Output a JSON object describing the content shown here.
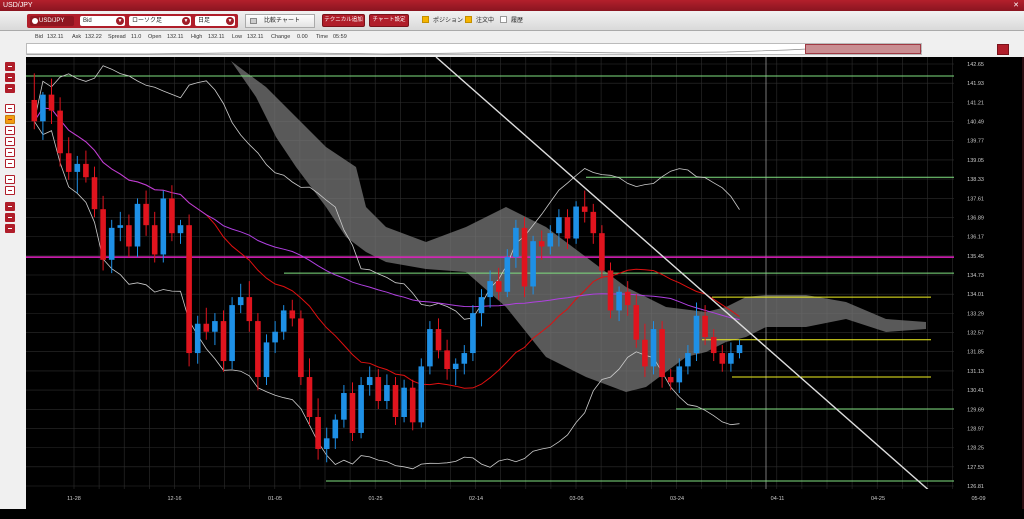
{
  "window": {
    "title": "USD/JPY",
    "close_glyph": "✕"
  },
  "toolbar": {
    "symbol": "USD/JPY",
    "price_type": "Bid",
    "chart_type": "ローソク足",
    "period": "日足",
    "compare_label": "比較チャート",
    "add_technical_label": "テクニカル追加",
    "chart_settings_label": "チャート設定",
    "checks": [
      {
        "label": "ポジション",
        "checked": true
      },
      {
        "label": "注文中",
        "checked": true
      },
      {
        "label": "履歴",
        "checked": false
      }
    ]
  },
  "quote": {
    "bid_label": "Bid",
    "bid": "132.11",
    "ask_label": "Ask",
    "ask": "132.22",
    "spread_label": "Spread",
    "spread": "11.0",
    "open_label": "Open",
    "open": "132.11",
    "high_label": "High",
    "high": "132.11",
    "low_label": "Low",
    "low": "132.11",
    "change_label": "Change",
    "change": "0.00",
    "time_label": "Time",
    "time": "05:59"
  },
  "left_tools": [
    "cursor-tool",
    "zoom-tool",
    "scroll-tool",
    "trendline-tool",
    "pen-tool",
    "horizontal-line-tool",
    "vertical-line-tool",
    "channel-tool",
    "fibonacci-tool",
    "text-tool",
    "delete-tool",
    "lock-tool",
    "save-tool",
    "settings-tool"
  ],
  "chart_data": {
    "type": "candlestick",
    "yaxis_ticks": [
      "142.65",
      "141.93",
      "141.21",
      "140.49",
      "139.77",
      "139.05",
      "138.33",
      "137.61",
      "136.89",
      "136.17",
      "135.45",
      "134.73",
      "134.01",
      "133.29",
      "132.57",
      "131.85",
      "131.13",
      "130.41",
      "129.69",
      "128.97",
      "128.25",
      "127.53",
      "126.81"
    ],
    "ylim": [
      126.81,
      142.65
    ],
    "xaxis_ticks": [
      "11-28",
      "12-16",
      "01-05",
      "01-25",
      "02-14",
      "03-06",
      "03-24",
      "04-11",
      "04-25",
      "05-09"
    ],
    "colors": {
      "up": "#1e90e6",
      "down": "#e0141e",
      "ma_short": "#e01010",
      "ma_long": "#b040e0",
      "bollinger": "#cccccc",
      "cloud": "#777777",
      "horizontal_magenta": "#e020c0",
      "horizontal_green": "#80e080",
      "horizontal_yellow": "#f0f020",
      "trendline": "#dddddd"
    },
    "candles": [
      [
        141.3,
        142.3,
        140.2,
        140.5
      ],
      [
        140.5,
        141.6,
        139.8,
        141.5
      ],
      [
        141.5,
        142.1,
        140.4,
        140.9
      ],
      [
        140.9,
        141.4,
        138.8,
        139.3
      ],
      [
        139.3,
        139.9,
        138.3,
        138.6
      ],
      [
        138.6,
        139.2,
        137.8,
        138.9
      ],
      [
        138.9,
        139.4,
        138.2,
        138.4
      ],
      [
        138.4,
        138.8,
        136.9,
        137.2
      ],
      [
        137.2,
        137.7,
        134.9,
        135.3
      ],
      [
        135.3,
        136.8,
        134.8,
        136.5
      ],
      [
        136.5,
        137.1,
        136.0,
        136.6
      ],
      [
        136.6,
        137.0,
        135.4,
        135.8
      ],
      [
        135.8,
        137.6,
        135.4,
        137.4
      ],
      [
        137.4,
        137.9,
        136.2,
        136.6
      ],
      [
        136.6,
        137.1,
        135.2,
        135.5
      ],
      [
        135.5,
        137.9,
        135.2,
        137.6
      ],
      [
        137.6,
        138.1,
        136.0,
        136.3
      ],
      [
        136.3,
        136.8,
        135.9,
        136.6
      ],
      [
        136.6,
        137.0,
        131.3,
        131.8
      ],
      [
        131.8,
        133.2,
        131.4,
        132.9
      ],
      [
        132.9,
        133.5,
        132.3,
        132.6
      ],
      [
        132.6,
        133.3,
        132.1,
        133.0
      ],
      [
        133.0,
        133.4,
        131.1,
        131.5
      ],
      [
        131.5,
        133.9,
        131.2,
        133.6
      ],
      [
        133.6,
        134.4,
        133.3,
        133.9
      ],
      [
        133.9,
        134.5,
        132.6,
        133.0
      ],
      [
        133.0,
        133.3,
        130.4,
        130.9
      ],
      [
        130.9,
        132.5,
        130.6,
        132.2
      ],
      [
        132.2,
        133.0,
        131.8,
        132.6
      ],
      [
        132.6,
        133.6,
        132.3,
        133.4
      ],
      [
        133.4,
        133.8,
        132.8,
        133.1
      ],
      [
        133.1,
        133.4,
        130.6,
        130.9
      ],
      [
        130.9,
        131.6,
        129.1,
        129.4
      ],
      [
        129.4,
        130.1,
        127.8,
        128.2
      ],
      [
        128.2,
        129.0,
        127.7,
        128.6
      ],
      [
        128.6,
        129.5,
        128.2,
        129.3
      ],
      [
        129.3,
        130.6,
        129.0,
        130.3
      ],
      [
        130.3,
        130.7,
        128.5,
        128.8
      ],
      [
        128.8,
        130.9,
        128.6,
        130.6
      ],
      [
        130.6,
        131.3,
        130.2,
        130.9
      ],
      [
        130.9,
        131.2,
        129.7,
        130.0
      ],
      [
        130.0,
        131.0,
        129.7,
        130.6
      ],
      [
        130.6,
        130.9,
        129.1,
        129.4
      ],
      [
        129.4,
        130.8,
        129.2,
        130.5
      ],
      [
        130.5,
        130.8,
        128.9,
        129.2
      ],
      [
        129.2,
        131.6,
        129.0,
        131.3
      ],
      [
        131.3,
        133.0,
        131.0,
        132.7
      ],
      [
        132.7,
        133.1,
        131.6,
        131.9
      ],
      [
        131.9,
        132.3,
        130.8,
        131.2
      ],
      [
        131.2,
        131.6,
        130.6,
        131.4
      ],
      [
        131.4,
        132.1,
        131.0,
        131.8
      ],
      [
        131.8,
        133.6,
        131.5,
        133.3
      ],
      [
        133.3,
        134.2,
        132.8,
        133.9
      ],
      [
        133.9,
        134.9,
        133.5,
        134.5
      ],
      [
        134.5,
        135.0,
        133.8,
        134.1
      ],
      [
        134.1,
        135.7,
        133.9,
        135.4
      ],
      [
        135.4,
        136.8,
        135.0,
        136.5
      ],
      [
        136.5,
        136.9,
        133.9,
        134.3
      ],
      [
        134.3,
        136.2,
        134.0,
        136.0
      ],
      [
        136.0,
        136.4,
        135.3,
        135.8
      ],
      [
        135.8,
        136.6,
        135.5,
        136.3
      ],
      [
        136.3,
        137.2,
        135.8,
        136.9
      ],
      [
        136.9,
        137.2,
        135.7,
        136.1
      ],
      [
        136.1,
        137.5,
        135.9,
        137.3
      ],
      [
        137.3,
        137.9,
        136.7,
        137.1
      ],
      [
        137.1,
        137.4,
        135.9,
        136.3
      ],
      [
        136.3,
        136.6,
        134.6,
        134.9
      ],
      [
        134.9,
        135.2,
        133.1,
        133.4
      ],
      [
        133.4,
        134.3,
        133.0,
        134.1
      ],
      [
        134.1,
        134.5,
        133.2,
        133.6
      ],
      [
        133.6,
        134.0,
        132.0,
        132.3
      ],
      [
        132.3,
        132.9,
        130.9,
        131.3
      ],
      [
        131.3,
        133.0,
        131.0,
        132.7
      ],
      [
        132.7,
        133.0,
        130.5,
        130.9
      ],
      [
        130.9,
        131.2,
        130.4,
        130.7
      ],
      [
        130.7,
        131.6,
        130.3,
        131.3
      ],
      [
        131.3,
        132.1,
        131.0,
        131.8
      ],
      [
        131.8,
        133.7,
        131.5,
        133.2
      ],
      [
        133.2,
        133.6,
        132.1,
        132.4
      ],
      [
        132.4,
        132.7,
        131.5,
        131.8
      ],
      [
        131.8,
        132.1,
        131.1,
        131.4
      ],
      [
        131.4,
        132.2,
        131.1,
        131.8
      ],
      [
        131.8,
        132.3,
        131.6,
        132.1
      ]
    ],
    "lines": {
      "magenta_level": 135.4,
      "green_levels": [
        142.2,
        138.4,
        134.8,
        129.7,
        127.0
      ],
      "yellow_levels": [
        133.9,
        132.3,
        130.9
      ]
    }
  }
}
